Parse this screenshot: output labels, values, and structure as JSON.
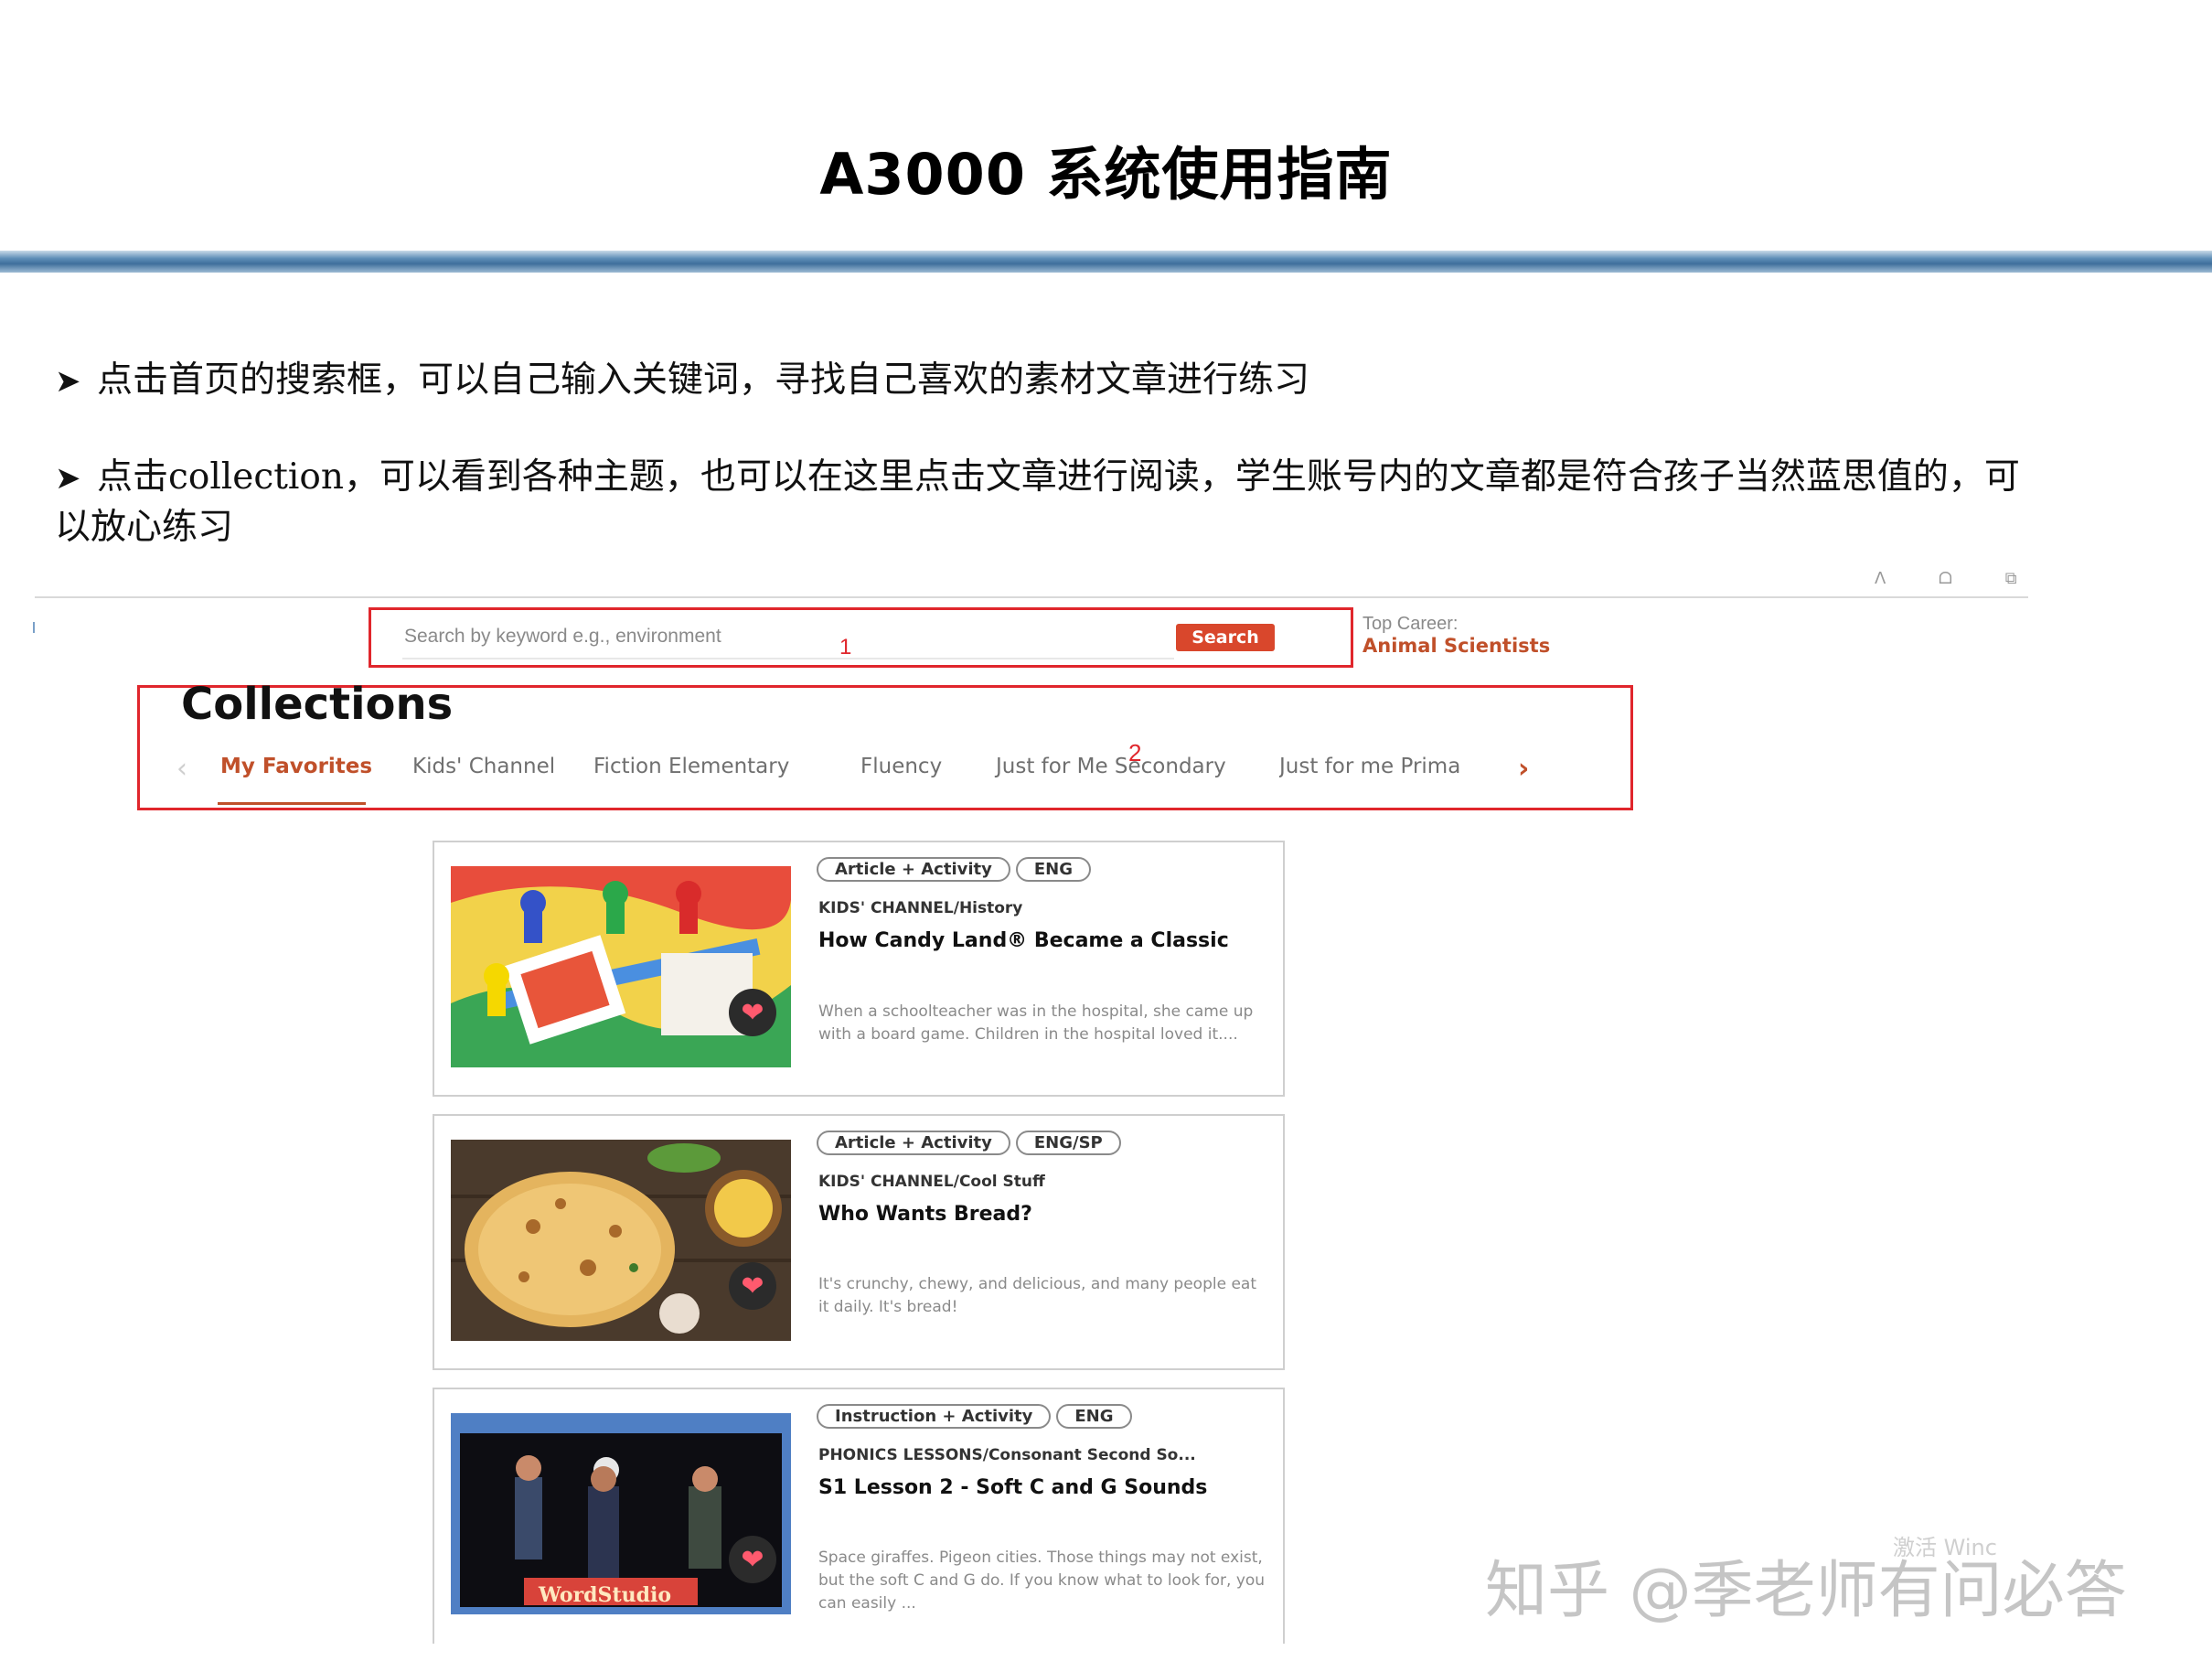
{
  "slide": {
    "title": "A3000  系统使用指南",
    "bullets": [
      "点击首页的搜索框，可以自己输入关键词，寻找自己喜欢的素材文章进行练习",
      "点击collection，可以看到各种主题，也可以在这里点击文章进行阅读，学生账号内的文章都是符合孩子当然蓝思值的，可以放心练习"
    ]
  },
  "search": {
    "placeholder": "Search by keyword e.g., environment",
    "button_label": "Search",
    "marker": "1"
  },
  "top_career": {
    "label": "Top Career:",
    "value": "Animal Scientists"
  },
  "collections": {
    "title": "Collections",
    "marker": "2",
    "tabs": [
      {
        "label": "My Favorites",
        "active": true
      },
      {
        "label": "Kids' Channel",
        "active": false
      },
      {
        "label": "Fiction Elementary",
        "active": false
      },
      {
        "label": "Fluency",
        "active": false
      },
      {
        "label": "Just for Me Secondary",
        "active": false
      },
      {
        "label": "Just for me Prima",
        "active": false
      }
    ]
  },
  "cards": [
    {
      "badges": [
        "Article + Activity",
        "ENG"
      ],
      "crumb": "KIDS' CHANNEL/History",
      "title": "How Candy Land® Became a Classic",
      "desc": "When a schoolteacher was in the hospital, she came up with a board game. Children in the hospital loved it...."
    },
    {
      "badges": [
        "Article + Activity",
        "ENG/SP"
      ],
      "crumb": "KIDS' CHANNEL/Cool Stuff",
      "title": "Who Wants Bread?",
      "desc": "It's crunchy, chewy, and delicious, and many people eat it daily. It's bread!"
    },
    {
      "badges": [
        "Instruction + Activity",
        "ENG"
      ],
      "crumb": "PHONICS LESSONS/Consonant Second So...",
      "title": "S1 Lesson 2 - Soft C and G Sounds",
      "desc": "Space giraffes. Pigeon cities. Those things may not exist, but the soft C and G do. If you know what to look for, you can easily ...",
      "thumb_caption": "WordStudio"
    }
  ],
  "watermark": "知乎 @季老师有问必答",
  "overlay_text": "激活 Winc",
  "icons": [
    "heart-icon",
    "chevron-left-icon",
    "chevron-right-icon",
    "bullet-arrow-icon"
  ],
  "colors": {
    "accent": "#c0502a",
    "highlight_frame": "#e0262c",
    "search_button": "#d9472c"
  }
}
